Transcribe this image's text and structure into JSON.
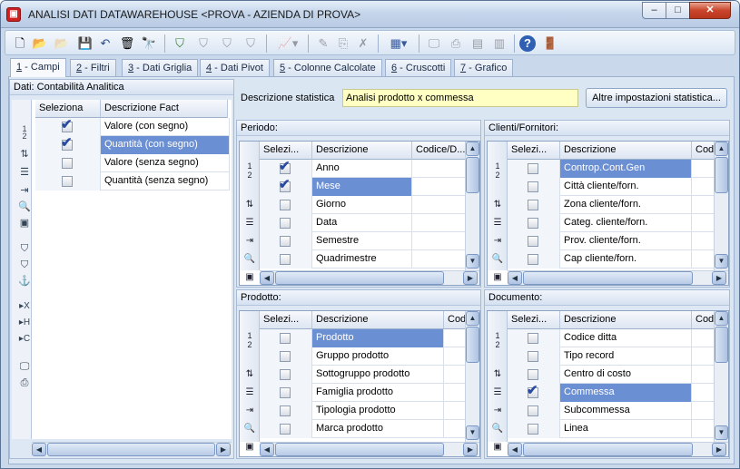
{
  "window": {
    "title": "ANALISI DATI DATAWAREHOUSE <PROVA - AZIENDA DI PROVA>",
    "controls": {
      "minimize": "–",
      "maximize": "□",
      "close": "✕"
    }
  },
  "toolbar": {
    "icons": [
      "new-icon",
      "open-icon",
      "open-disabled-icon",
      "save-icon",
      "undo-icon",
      "delete-icon",
      "find-icon",
      "filter-add-icon",
      "filter-edit-icon",
      "filter-remove-icon",
      "filter-clear-icon",
      "chart-icon",
      "edit-icon",
      "copy-icon",
      "erase-icon",
      "grid-icon",
      "monitor-icon",
      "print-icon",
      "export-icon",
      "import-icon",
      "help-icon",
      "exit-icon"
    ]
  },
  "tabs": [
    {
      "key": "1",
      "label": " - Campi"
    },
    {
      "key": "2",
      "label": " - Filtri"
    },
    {
      "key": "3",
      "label": " - Dati Griglia"
    },
    {
      "key": "4",
      "label": " - Dati Pivot"
    },
    {
      "key": "5",
      "label": " - Colonne Calcolate"
    },
    {
      "key": "6",
      "label": " - Cruscotti"
    },
    {
      "key": "7",
      "label": " - Grafico"
    }
  ],
  "left_panel": {
    "header": "Dati: Contabilità Analitica",
    "columns": [
      "Seleziona",
      "Descrizione Fact"
    ],
    "rows": [
      {
        "label": "Valore (con segno)",
        "checked": true,
        "selected": false
      },
      {
        "label": "Quantità (con segno)",
        "checked": true,
        "selected": true
      },
      {
        "label": "Valore (senza segno)",
        "checked": false,
        "selected": false
      },
      {
        "label": "Quantità (senza segno)",
        "checked": false,
        "selected": false
      }
    ]
  },
  "descrizione": {
    "label": "Descrizione statistica",
    "value": "Analisi prodotto x commessa",
    "button": "Altre impostazioni statistica..."
  },
  "panels": {
    "periodo": {
      "header": "Periodo:",
      "columns": [
        "Selezi...",
        "Descrizione",
        "Codice/D..."
      ],
      "rows": [
        {
          "label": "Anno",
          "checked": true,
          "selected": false
        },
        {
          "label": "Mese",
          "checked": true,
          "selected": true
        },
        {
          "label": "Giorno",
          "checked": false,
          "selected": false
        },
        {
          "label": "Data",
          "checked": false,
          "selected": false
        },
        {
          "label": "Semestre",
          "checked": false,
          "selected": false
        },
        {
          "label": "Quadrimestre",
          "checked": false,
          "selected": false
        }
      ]
    },
    "clienti": {
      "header": "Clienti/Fornitori:",
      "columns": [
        "Selezi...",
        "Descrizione",
        "Codi"
      ],
      "rows": [
        {
          "label": "Controp.Cont.Gen",
          "checked": false,
          "selected": true
        },
        {
          "label": "Città cliente/forn.",
          "checked": false,
          "selected": false
        },
        {
          "label": "Zona cliente/forn.",
          "checked": false,
          "selected": false
        },
        {
          "label": "Categ. cliente/forn.",
          "checked": false,
          "selected": false
        },
        {
          "label": "Prov. cliente/forn.",
          "checked": false,
          "selected": false
        },
        {
          "label": "Cap cliente/forn.",
          "checked": false,
          "selected": false
        }
      ]
    },
    "prodotto": {
      "header": "Prodotto:",
      "columns": [
        "Selezi...",
        "Descrizione",
        "Codi"
      ],
      "rows": [
        {
          "label": "Prodotto",
          "checked": false,
          "selected": true
        },
        {
          "label": "Gruppo prodotto",
          "checked": false,
          "selected": false
        },
        {
          "label": "Sottogruppo prodotto",
          "checked": false,
          "selected": false
        },
        {
          "label": "Famiglia prodotto",
          "checked": false,
          "selected": false
        },
        {
          "label": "Tipologia prodotto",
          "checked": false,
          "selected": false
        },
        {
          "label": "Marca prodotto",
          "checked": false,
          "selected": false
        }
      ]
    },
    "documento": {
      "header": "Documento:",
      "columns": [
        "Selezi...",
        "Descrizione",
        "Codi"
      ],
      "rows": [
        {
          "label": "Codice ditta",
          "checked": false,
          "selected": false
        },
        {
          "label": "Tipo record",
          "checked": false,
          "selected": false
        },
        {
          "label": "Centro di costo",
          "checked": false,
          "selected": false
        },
        {
          "label": "Commessa",
          "checked": true,
          "selected": true
        },
        {
          "label": "Subcommessa",
          "checked": false,
          "selected": false
        },
        {
          "label": "Linea",
          "checked": false,
          "selected": false
        }
      ]
    }
  },
  "row_header_marks": {
    "first": "1",
    "second": "2"
  },
  "side_icons": [
    "sort-icon",
    "list-icon",
    "move-icon",
    "zoom-icon",
    "image-icon",
    "filter-icon",
    "filter-edit-icon",
    "anchor-icon",
    "remove-x-icon",
    "hide-icon",
    "collapse-icon",
    "monitor-icon",
    "print-icon"
  ]
}
